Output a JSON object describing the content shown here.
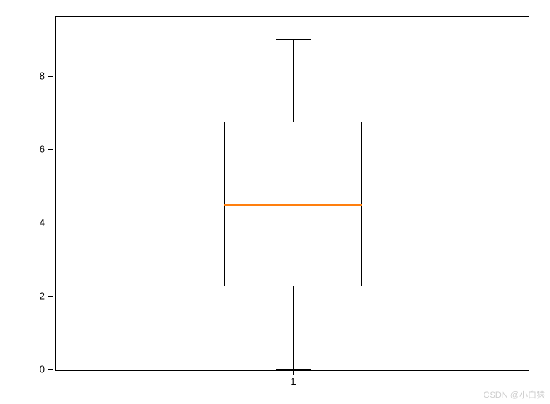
{
  "chart_data": {
    "type": "boxplot",
    "categories": [
      "1"
    ],
    "series": [
      {
        "name": "1",
        "min": 0,
        "q1": 2.25,
        "median": 4.5,
        "q3": 6.75,
        "max": 9
      }
    ],
    "title": "",
    "xlabel": "",
    "ylabel": "",
    "ylim": [
      -0.5,
      9.2
    ],
    "y_ticks": [
      0,
      2,
      4,
      6,
      8
    ],
    "x_ticks": [
      "1"
    ],
    "median_color": "#ff7f0e"
  },
  "watermark": "CSDN @小白猿"
}
